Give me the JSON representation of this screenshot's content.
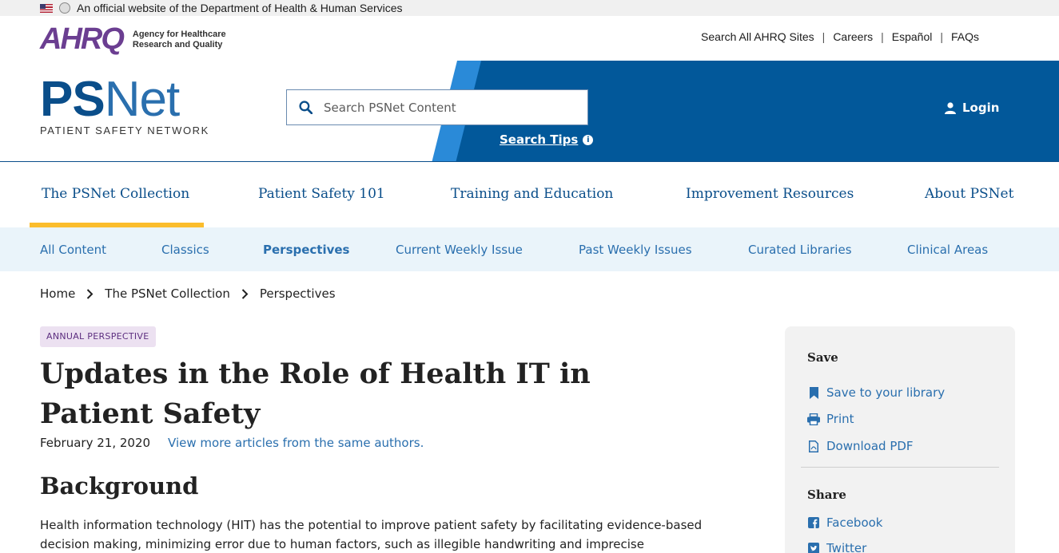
{
  "gov_banner": {
    "text": "An official website of the Department of Health & Human Services"
  },
  "ahrq": {
    "mark": "AHRQ",
    "line1": "Agency for Healthcare",
    "line2": "Research and Quality"
  },
  "utility_nav": [
    "Search All AHRQ Sites",
    "Careers",
    "Español",
    "FAQs"
  ],
  "psnet": {
    "ps": "PS",
    "net": "Net",
    "subtitle": "PATIENT SAFETY NETWORK"
  },
  "search": {
    "placeholder": "Search PSNet Content",
    "tips": "Search Tips"
  },
  "login": "Login",
  "main_nav": [
    "The PSNet Collection",
    "Patient Safety 101",
    "Training and Education",
    "Improvement Resources",
    "About PSNet"
  ],
  "sub_nav": [
    "All Content",
    "Classics",
    "Perspectives",
    "Current Weekly Issue",
    "Past Weekly Issues",
    "Curated Libraries",
    "Clinical Areas"
  ],
  "breadcrumb": [
    "Home",
    "The PSNet Collection",
    "Perspectives"
  ],
  "article": {
    "tag": "ANNUAL PERSPECTIVE",
    "title": "Updates in the Role of Health IT in Patient Safety",
    "date": "February 21, 2020",
    "authors_link": "View more articles from the same authors.",
    "section": "Background",
    "paragraph": "Health information technology (HIT) has the potential to improve patient safety by facilitating evidence-based decision making, minimizing error due to human factors, such as illegible handwriting and imprecise"
  },
  "sidebar": {
    "save_heading": "Save",
    "save_library": "Save to your library",
    "print": "Print",
    "download_pdf": "Download PDF",
    "share_heading": "Share",
    "facebook": "Facebook",
    "twitter": "Twitter"
  }
}
